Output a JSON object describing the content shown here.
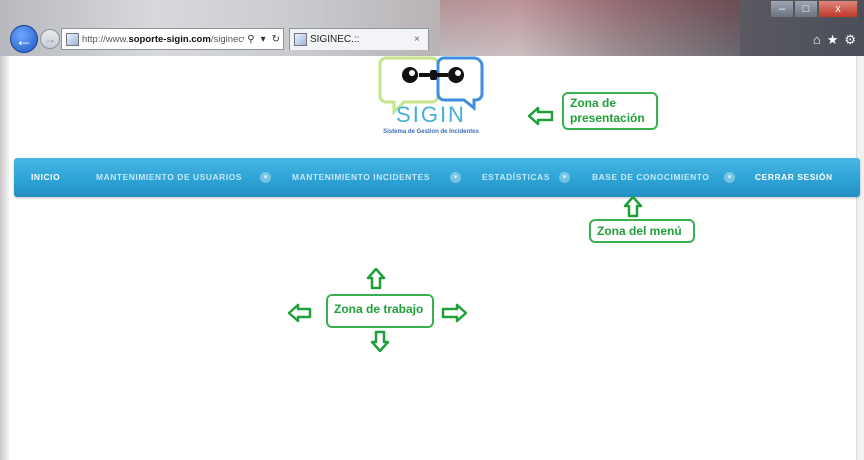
{
  "browser": {
    "url_prefix": "http://www.",
    "url_domain": "soporte-sigin.com",
    "url_path": "/siginecweb/menu",
    "search_icon": "search-icon",
    "tab_title": "SIGINEC.::",
    "tab_close": "×",
    "minimize": "–",
    "maximize": "□",
    "close": "x"
  },
  "logo": {
    "title": "SIGIN",
    "subtitle": "Sistema de Gestion de Incidentes",
    "bubble_left_color": "#c6e58a",
    "bubble_right_color": "#3f8fe0"
  },
  "menu": {
    "items": [
      {
        "label": "INICIO"
      },
      {
        "label": "MANTENIMIENTO DE USUARIOS"
      },
      {
        "label": "MANTENIMIENTO INCIDENTES"
      },
      {
        "label": "ESTADÍSTICAS"
      },
      {
        "label": "BASE DE CONOCIMIENTO"
      },
      {
        "label": "CERRAR SESIÓN"
      }
    ],
    "background_color": "#2ea3d6"
  },
  "annotations": {
    "presentation_line1": "Zona de",
    "presentation_line2": "presentación",
    "menu_zone": "Zona del menú",
    "work_zone": "Zona de trabajo",
    "color": "#21a03a"
  }
}
